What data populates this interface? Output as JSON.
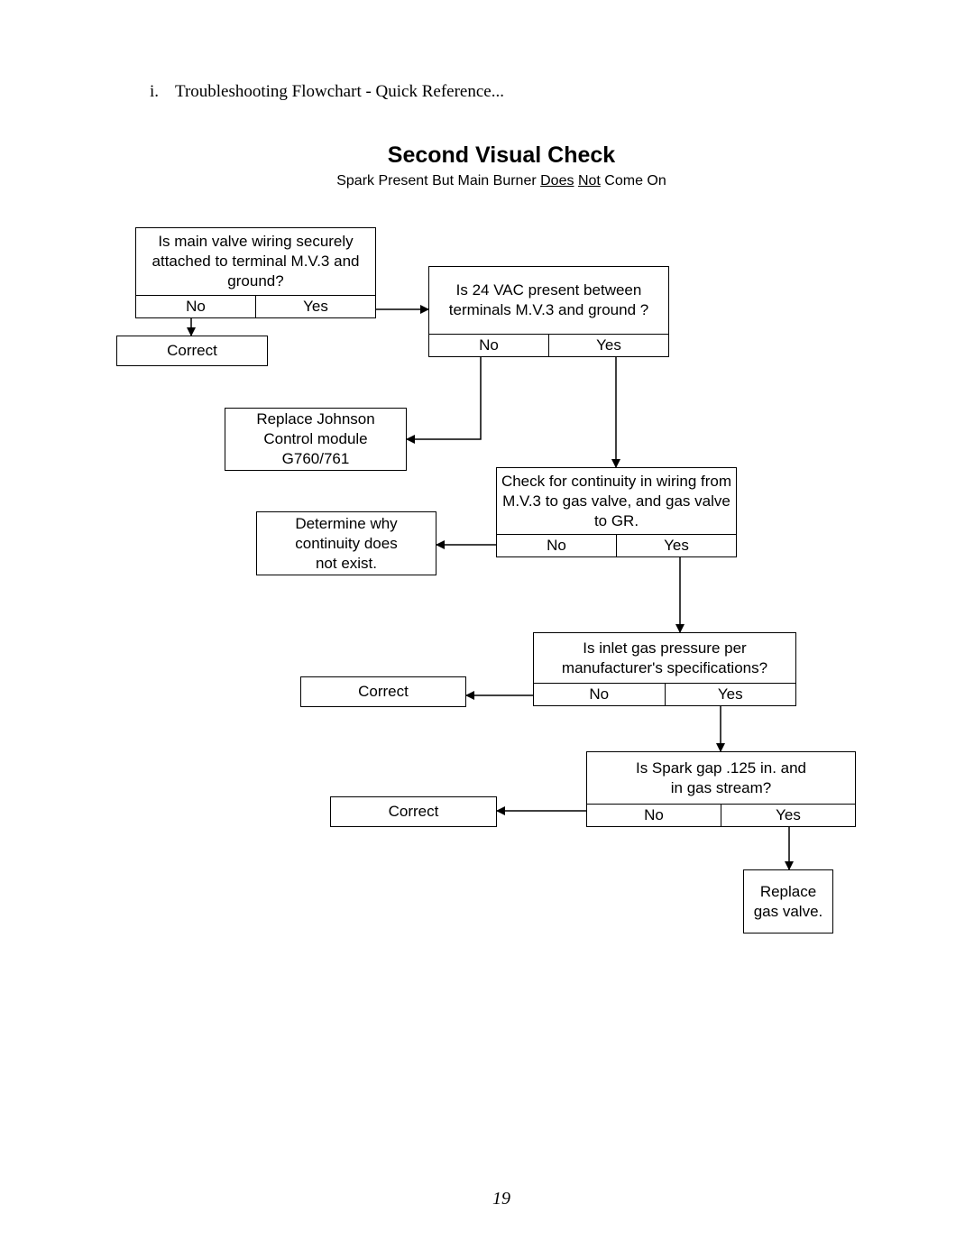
{
  "header": {
    "item_number": "i.",
    "item_text": "Troubleshooting Flowchart - Quick Reference..."
  },
  "title": "Second Visual Check",
  "subtitle": {
    "prefix": "Spark Present But Main Burner ",
    "underlined_1": "Does",
    "middle": " ",
    "underlined_2": "Not",
    "suffix": " Come On"
  },
  "flowchart": {
    "q1": {
      "question": "Is main valve wiring securely attached to terminal M.V.3 and ground?",
      "no": "No",
      "yes": "Yes"
    },
    "a1": {
      "text": "Correct"
    },
    "q2": {
      "question": "Is 24 VAC present between terminals M.V.3 and ground ?",
      "no": "No",
      "yes": "Yes"
    },
    "a2": {
      "text": "Replace Johnson Control module G760/761"
    },
    "q3": {
      "question": "Check for continuity in wiring from M.V.3 to gas valve, and gas valve to GR.",
      "no": "No",
      "yes": "Yes"
    },
    "a3": {
      "text": "Determine why continuity does not exist."
    },
    "q4": {
      "question": "Is inlet gas pressure per manufacturer's specifications?",
      "no": "No",
      "yes": "Yes"
    },
    "a4": {
      "text": "Correct"
    },
    "q5": {
      "question": "Is Spark gap .125 in. and in gas stream?",
      "no": "No",
      "yes": "Yes"
    },
    "a5": {
      "text": "Correct"
    },
    "a6": {
      "text": "Replace gas valve."
    }
  },
  "page_number": "19"
}
